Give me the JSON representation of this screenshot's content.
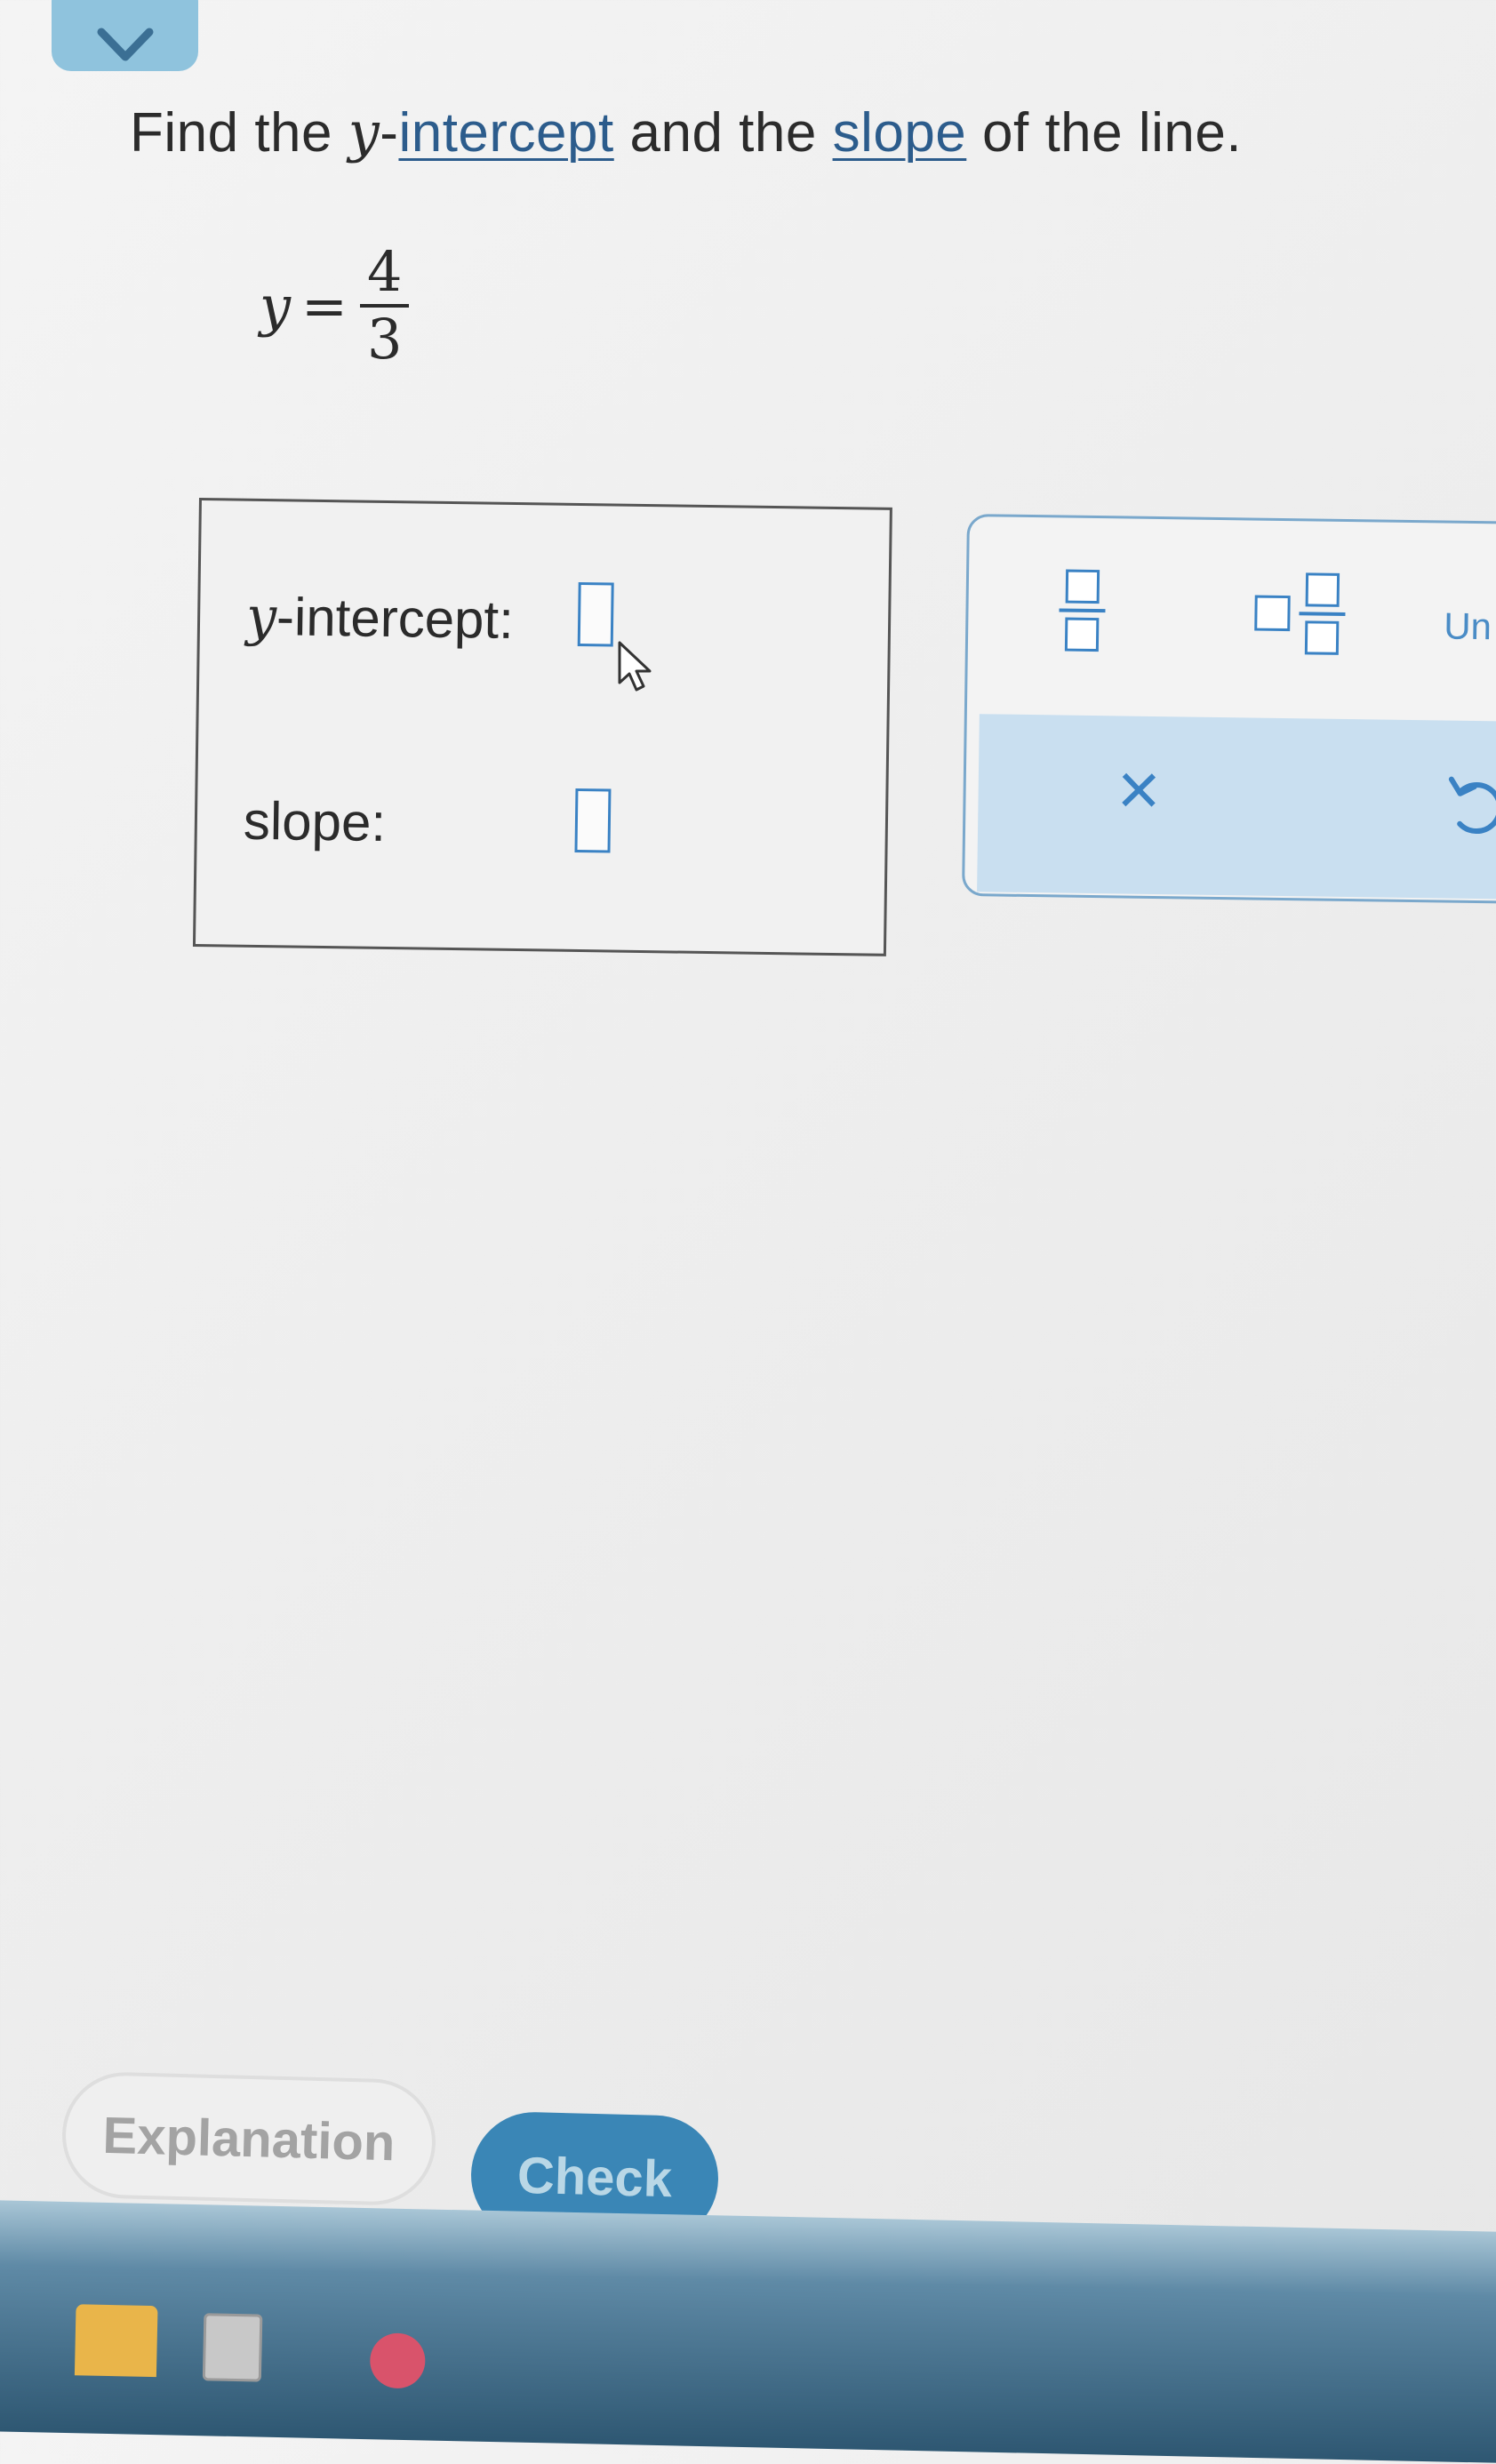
{
  "header": {
    "collapse_icon": "chevron-down-icon"
  },
  "question": {
    "prefix": "Find the ",
    "var": "y",
    "dash": "-",
    "link1": "intercept",
    "middle": " and the ",
    "link2": "slope",
    "suffix": " of the line."
  },
  "equation": {
    "lhs": "y",
    "sign": "=",
    "numerator": "4",
    "denominator": "3"
  },
  "answers": {
    "intercept_var": "y",
    "intercept_label": "-intercept:",
    "slope_label": "slope:",
    "intercept_value": "",
    "slope_value": ""
  },
  "toolbar": {
    "fraction_icon": "fraction-icon",
    "mixed_number_icon": "mixed-number-icon",
    "units_label": "Un",
    "clear_symbol": "×",
    "undo_icon": "undo-icon"
  },
  "buttons": {
    "explanation": "Explanation",
    "check": "Check"
  },
  "colors": {
    "accent": "#3a82c4",
    "link": "#2c5c8c",
    "check_button": "#3a86b6",
    "toolbar_bottom": "#c9dff0"
  }
}
